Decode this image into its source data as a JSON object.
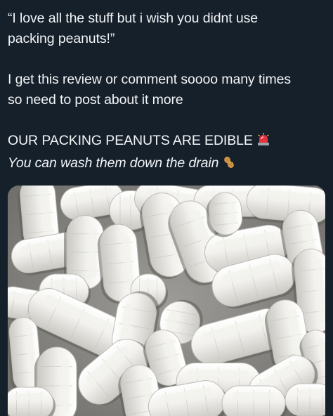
{
  "post": {
    "paragraphs": [
      {
        "lines": [
          "“I love all the stuff but i wish you didnt use",
          "packing peanuts!”"
        ]
      },
      {
        "lines": [
          "I get this review or comment soooo many times",
          "so need to post about it more"
        ]
      }
    ],
    "headline": "OUR PACKING PEANUTS ARE EDIBLE",
    "headline_emoji": "police-light-icon",
    "subline": "You can wash them down the drain",
    "subline_emoji": "peanut-icon"
  },
  "colors": {
    "background": "#16202b",
    "text": "#f2f4f6",
    "peanut_fill": "#f3f2ee",
    "peanut_shadow": "#bdbcb7"
  }
}
